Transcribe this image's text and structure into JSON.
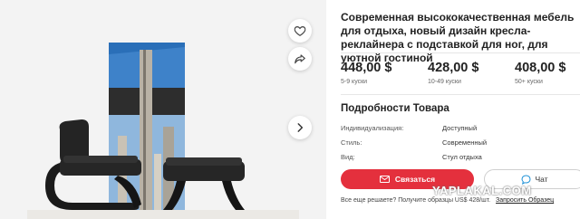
{
  "product": {
    "title": "Современная высококачественная мебель для отдыха, новый дизайн кресла-реклайнера с подставкой для ног, для уютной гостиной"
  },
  "prices": [
    {
      "amount": "448,00 $",
      "quantity": "5-9 куски"
    },
    {
      "amount": "428,00 $",
      "quantity": "10-49 куски"
    },
    {
      "amount": "408,00 $",
      "quantity": "50+ куски"
    }
  ],
  "details": {
    "title": "Подробности Товара",
    "rows": [
      {
        "label": "Индивидуализация:",
        "value": "Доступный"
      },
      {
        "label": "Стиль:",
        "value": "Современный"
      },
      {
        "label": "Вид:",
        "value": "Стул отдыха"
      }
    ]
  },
  "actions": {
    "contact_label": "Связаться",
    "chat_label": "Чат"
  },
  "footer": {
    "question": "Все еще решаете? Получите образцы US$ 428/шт.",
    "sample_link": "Запросить Образец"
  },
  "watermark": "YAPLAKAL.COM",
  "icons": {
    "favorite": "heart-icon",
    "share": "share-icon",
    "next": "chevron-right-icon",
    "contact": "envelope-icon",
    "chat": "chat-bubble-icon"
  },
  "colors": {
    "accent": "#e4303d",
    "image_background": "#f3f3f3"
  }
}
